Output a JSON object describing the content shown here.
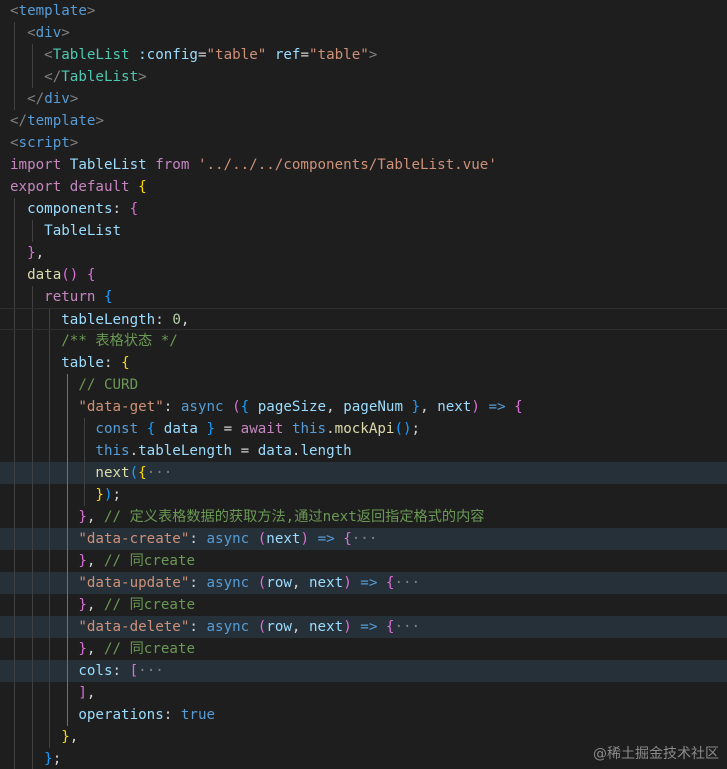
{
  "lines": [
    {
      "indent": 0,
      "tokens": [
        [
          "tk-br",
          "<"
        ],
        [
          "tk-tag",
          "template"
        ],
        [
          "tk-br",
          ">"
        ]
      ]
    },
    {
      "indent": 1,
      "tokens": [
        [
          "tk-br",
          "<"
        ],
        [
          "tk-tag",
          "div"
        ],
        [
          "tk-br",
          ">"
        ]
      ]
    },
    {
      "indent": 2,
      "tokens": [
        [
          "tk-br",
          "<"
        ],
        [
          "tk-comp",
          "TableList"
        ],
        [
          "tk-p",
          " "
        ],
        [
          "tk-attr",
          ":config"
        ],
        [
          "tk-p",
          "="
        ],
        [
          "tk-str",
          "\"table\""
        ],
        [
          "tk-p",
          " "
        ],
        [
          "tk-attr",
          "ref"
        ],
        [
          "tk-p",
          "="
        ],
        [
          "tk-str",
          "\"table\""
        ],
        [
          "tk-br",
          ">"
        ]
      ]
    },
    {
      "indent": 2,
      "tokens": [
        [
          "tk-br",
          "</"
        ],
        [
          "tk-comp",
          "TableList"
        ],
        [
          "tk-br",
          ">"
        ]
      ]
    },
    {
      "indent": 1,
      "tokens": [
        [
          "tk-br",
          "</"
        ],
        [
          "tk-tag",
          "div"
        ],
        [
          "tk-br",
          ">"
        ]
      ]
    },
    {
      "indent": 0,
      "tokens": [
        [
          "tk-br",
          "</"
        ],
        [
          "tk-tag",
          "template"
        ],
        [
          "tk-br",
          ">"
        ]
      ]
    },
    {
      "indent": 0,
      "tokens": [
        [
          "tk-br",
          "<"
        ],
        [
          "tk-tag",
          "script"
        ],
        [
          "tk-br",
          ">"
        ]
      ]
    },
    {
      "indent": 0,
      "tokens": [
        [
          "tk-kw",
          "import"
        ],
        [
          "tk-p",
          " "
        ],
        [
          "tk-prop",
          "TableList"
        ],
        [
          "tk-p",
          " "
        ],
        [
          "tk-kw",
          "from"
        ],
        [
          "tk-p",
          " "
        ],
        [
          "tk-str",
          "'../../../components/TableList.vue'"
        ]
      ]
    },
    {
      "indent": 0,
      "tokens": [
        [
          "tk-kw",
          "export"
        ],
        [
          "tk-p",
          " "
        ],
        [
          "tk-kw",
          "default"
        ],
        [
          "tk-p",
          " "
        ],
        [
          "tk-b1",
          "{"
        ]
      ]
    },
    {
      "indent": 1,
      "tokens": [
        [
          "tk-prop",
          "components"
        ],
        [
          "tk-p",
          ": "
        ],
        [
          "tk-b2",
          "{"
        ]
      ]
    },
    {
      "indent": 2,
      "tokens": [
        [
          "tk-prop",
          "TableList"
        ]
      ]
    },
    {
      "indent": 1,
      "tokens": [
        [
          "tk-b2",
          "}"
        ],
        [
          "tk-p",
          ","
        ]
      ]
    },
    {
      "indent": 1,
      "tokens": [
        [
          "tk-fn",
          "data"
        ],
        [
          "tk-b2",
          "()"
        ],
        [
          "tk-p",
          " "
        ],
        [
          "tk-b2",
          "{"
        ]
      ]
    },
    {
      "indent": 2,
      "tokens": [
        [
          "tk-kw",
          "return"
        ],
        [
          "tk-p",
          " "
        ],
        [
          "tk-b3",
          "{"
        ]
      ]
    },
    {
      "indent": 3,
      "cursor": true,
      "tokens": [
        [
          "tk-prop",
          "tableLength"
        ],
        [
          "tk-p",
          ": "
        ],
        [
          "tk-num",
          "0"
        ],
        [
          "tk-p",
          ","
        ]
      ]
    },
    {
      "indent": 3,
      "tokens": [
        [
          "tk-com",
          "/** 表格状态 */"
        ]
      ]
    },
    {
      "indent": 3,
      "tokens": [
        [
          "tk-prop",
          "table"
        ],
        [
          "tk-p",
          ": "
        ],
        [
          "tk-b1",
          "{"
        ]
      ]
    },
    {
      "indent": 4,
      "tokens": [
        [
          "tk-com",
          "// CURD"
        ]
      ]
    },
    {
      "indent": 4,
      "tokens": [
        [
          "tk-str",
          "\"data-get\""
        ],
        [
          "tk-p",
          ": "
        ],
        [
          "tk-kw2",
          "async"
        ],
        [
          "tk-p",
          " "
        ],
        [
          "tk-b2",
          "("
        ],
        [
          "tk-b3",
          "{"
        ],
        [
          "tk-p",
          " "
        ],
        [
          "tk-prop",
          "pageSize"
        ],
        [
          "tk-p",
          ", "
        ],
        [
          "tk-prop",
          "pageNum"
        ],
        [
          "tk-p",
          " "
        ],
        [
          "tk-b3",
          "}"
        ],
        [
          "tk-p",
          ", "
        ],
        [
          "tk-prop",
          "next"
        ],
        [
          "tk-b2",
          ")"
        ],
        [
          "tk-p",
          " "
        ],
        [
          "tk-kw2",
          "=>"
        ],
        [
          "tk-p",
          " "
        ],
        [
          "tk-b2",
          "{"
        ]
      ]
    },
    {
      "indent": 5,
      "tokens": [
        [
          "tk-kw2",
          "const"
        ],
        [
          "tk-p",
          " "
        ],
        [
          "tk-b3",
          "{"
        ],
        [
          "tk-p",
          " "
        ],
        [
          "tk-prop",
          "data"
        ],
        [
          "tk-p",
          " "
        ],
        [
          "tk-b3",
          "}"
        ],
        [
          "tk-p",
          " = "
        ],
        [
          "tk-kw",
          "await"
        ],
        [
          "tk-p",
          " "
        ],
        [
          "tk-kw2",
          "this"
        ],
        [
          "tk-p",
          "."
        ],
        [
          "tk-fn",
          "mockApi"
        ],
        [
          "tk-b3",
          "()"
        ],
        [
          "tk-p",
          ";"
        ]
      ]
    },
    {
      "indent": 5,
      "tokens": [
        [
          "tk-kw2",
          "this"
        ],
        [
          "tk-p",
          "."
        ],
        [
          "tk-prop",
          "tableLength"
        ],
        [
          "tk-p",
          " = "
        ],
        [
          "tk-prop",
          "data"
        ],
        [
          "tk-p",
          "."
        ],
        [
          "tk-prop",
          "length"
        ]
      ]
    },
    {
      "indent": 5,
      "hl": true,
      "fold": true,
      "tokens": [
        [
          "tk-fn",
          "next"
        ],
        [
          "tk-b3",
          "("
        ],
        [
          "tk-b1",
          "{"
        ],
        [
          "tk-el",
          "···"
        ]
      ]
    },
    {
      "indent": 5,
      "tokens": [
        [
          "tk-b1",
          "}"
        ],
        [
          "tk-b3",
          ")"
        ],
        [
          "tk-p",
          ";"
        ]
      ]
    },
    {
      "indent": 4,
      "tokens": [
        [
          "tk-b2",
          "}"
        ],
        [
          "tk-p",
          ", "
        ],
        [
          "tk-com",
          "// 定义表格数据的获取方法,通过next返回指定格式的内容"
        ]
      ]
    },
    {
      "indent": 4,
      "hl": true,
      "fold": true,
      "tokens": [
        [
          "tk-str",
          "\"data-create\""
        ],
        [
          "tk-p",
          ": "
        ],
        [
          "tk-kw2",
          "async"
        ],
        [
          "tk-p",
          " "
        ],
        [
          "tk-b2",
          "("
        ],
        [
          "tk-prop",
          "next"
        ],
        [
          "tk-b2",
          ")"
        ],
        [
          "tk-p",
          " "
        ],
        [
          "tk-kw2",
          "=>"
        ],
        [
          "tk-p",
          " "
        ],
        [
          "tk-b2",
          "{"
        ],
        [
          "tk-el",
          "···"
        ]
      ]
    },
    {
      "indent": 4,
      "tokens": [
        [
          "tk-b2",
          "}"
        ],
        [
          "tk-p",
          ", "
        ],
        [
          "tk-com",
          "// 同create"
        ]
      ]
    },
    {
      "indent": 4,
      "hl": true,
      "fold": true,
      "tokens": [
        [
          "tk-str",
          "\"data-update\""
        ],
        [
          "tk-p",
          ": "
        ],
        [
          "tk-kw2",
          "async"
        ],
        [
          "tk-p",
          " "
        ],
        [
          "tk-b2",
          "("
        ],
        [
          "tk-prop",
          "row"
        ],
        [
          "tk-p",
          ", "
        ],
        [
          "tk-prop",
          "next"
        ],
        [
          "tk-b2",
          ")"
        ],
        [
          "tk-p",
          " "
        ],
        [
          "tk-kw2",
          "=>"
        ],
        [
          "tk-p",
          " "
        ],
        [
          "tk-b2",
          "{"
        ],
        [
          "tk-el",
          "···"
        ]
      ]
    },
    {
      "indent": 4,
      "tokens": [
        [
          "tk-b2",
          "}"
        ],
        [
          "tk-p",
          ", "
        ],
        [
          "tk-com",
          "// 同create"
        ]
      ]
    },
    {
      "indent": 4,
      "hl": true,
      "fold": true,
      "tokens": [
        [
          "tk-str",
          "\"data-delete\""
        ],
        [
          "tk-p",
          ": "
        ],
        [
          "tk-kw2",
          "async"
        ],
        [
          "tk-p",
          " "
        ],
        [
          "tk-b2",
          "("
        ],
        [
          "tk-prop",
          "row"
        ],
        [
          "tk-p",
          ", "
        ],
        [
          "tk-prop",
          "next"
        ],
        [
          "tk-b2",
          ")"
        ],
        [
          "tk-p",
          " "
        ],
        [
          "tk-kw2",
          "=>"
        ],
        [
          "tk-p",
          " "
        ],
        [
          "tk-b2",
          "{"
        ],
        [
          "tk-el",
          "···"
        ]
      ]
    },
    {
      "indent": 4,
      "tokens": [
        [
          "tk-b2",
          "}"
        ],
        [
          "tk-p",
          ", "
        ],
        [
          "tk-com",
          "// 同create"
        ]
      ]
    },
    {
      "indent": 4,
      "hl": true,
      "fold": true,
      "tokens": [
        [
          "tk-prop",
          "cols"
        ],
        [
          "tk-p",
          ": "
        ],
        [
          "tk-b2",
          "["
        ],
        [
          "tk-el",
          "···"
        ]
      ]
    },
    {
      "indent": 4,
      "tokens": [
        [
          "tk-b2",
          "]"
        ],
        [
          "tk-p",
          ","
        ]
      ]
    },
    {
      "indent": 4,
      "tokens": [
        [
          "tk-prop",
          "operations"
        ],
        [
          "tk-p",
          ": "
        ],
        [
          "tk-kw2",
          "true"
        ]
      ]
    },
    {
      "indent": 3,
      "tokens": [
        [
          "tk-b1",
          "}"
        ],
        [
          "tk-p",
          ","
        ]
      ]
    },
    {
      "indent": 2,
      "tokens": [
        [
          "tk-b3",
          "}"
        ],
        [
          "tk-p",
          ";"
        ]
      ]
    }
  ],
  "watermark": "@稀土掘金技术社区",
  "colors": {
    "background": "#1e1e1e",
    "line_highlight": "#263039"
  }
}
